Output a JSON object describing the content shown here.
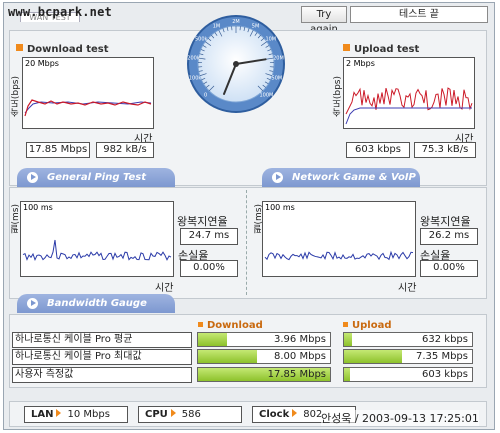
{
  "watermark": "www.bcpark.net",
  "top_tab": "WAN TEST",
  "header": {
    "try_again": "Try again",
    "status": "테스트 끝"
  },
  "download": {
    "title": "Download test",
    "axis_label": "속도(bps)",
    "scale": "20 Mbps",
    "time_label": "시간",
    "mbps": "17.85 Mbps",
    "kbs": "982 kB/s"
  },
  "upload": {
    "title": "Upload test",
    "axis_label": "속도(bps)",
    "scale": "2 Mbps",
    "time_label": "시간",
    "kbps": "603 kbps",
    "kbs": "75.3 kB/s"
  },
  "gauge": {
    "ticks": [
      "0",
      "100k",
      "200k",
      "500k",
      "1M",
      "2M",
      "5M",
      "10M",
      "20M",
      "50M",
      "100M"
    ],
    "needle_value": "20M"
  },
  "ping": {
    "title": "General Ping Test",
    "axis_label": "필(ms)",
    "scale": "100 ms",
    "time_label": "시간",
    "rtt_label": "왕복지연율",
    "rtt_value": "24.7 ms",
    "loss_label": "손실율",
    "loss_value": "0.00%"
  },
  "game": {
    "title": "Network Game & VoIP Test",
    "axis_label": "필(ms)",
    "scale": "100 ms",
    "time_label": "시간",
    "rtt_label": "왕복지연율",
    "rtt_value": "26.2 ms",
    "loss_label": "손실율",
    "loss_value": "0.00%"
  },
  "bandwidth": {
    "title": "Bandwidth Gauge",
    "download_header": "Download",
    "upload_header": "Upload",
    "rows": [
      {
        "label": "하나로통신 케이블 Pro 평균",
        "download": "3.96 Mbps",
        "download_fill": 0.22,
        "upload": "632 kbps",
        "upload_fill": 0.06
      },
      {
        "label": "하나로통신 케이블 Pro 최대값",
        "download": "8.00 Mbps",
        "download_fill": 0.45,
        "upload": "7.35 Mbps",
        "upload_fill": 0.45
      },
      {
        "label": "사용자 측정값",
        "download": "17.85 Mbps",
        "download_fill": 1.0,
        "upload": "603 kbps",
        "upload_fill": 0.05
      }
    ]
  },
  "footer": {
    "lan_label": "LAN",
    "lan_value": "10 Mbps",
    "cpu_label": "CPU",
    "cpu_value": "586",
    "clock_label": "Clock",
    "clock_value": "802",
    "signature": "안성욱 / 2003-09-13 17:25:01"
  },
  "colors": {
    "accent": "#f08a1c",
    "banner": "#7d98d0",
    "bar_fill": "#8ec22c",
    "download_line": "#cc1a28",
    "download_ref": "#3b3bb0",
    "ping_line": "#2a3aa8"
  }
}
